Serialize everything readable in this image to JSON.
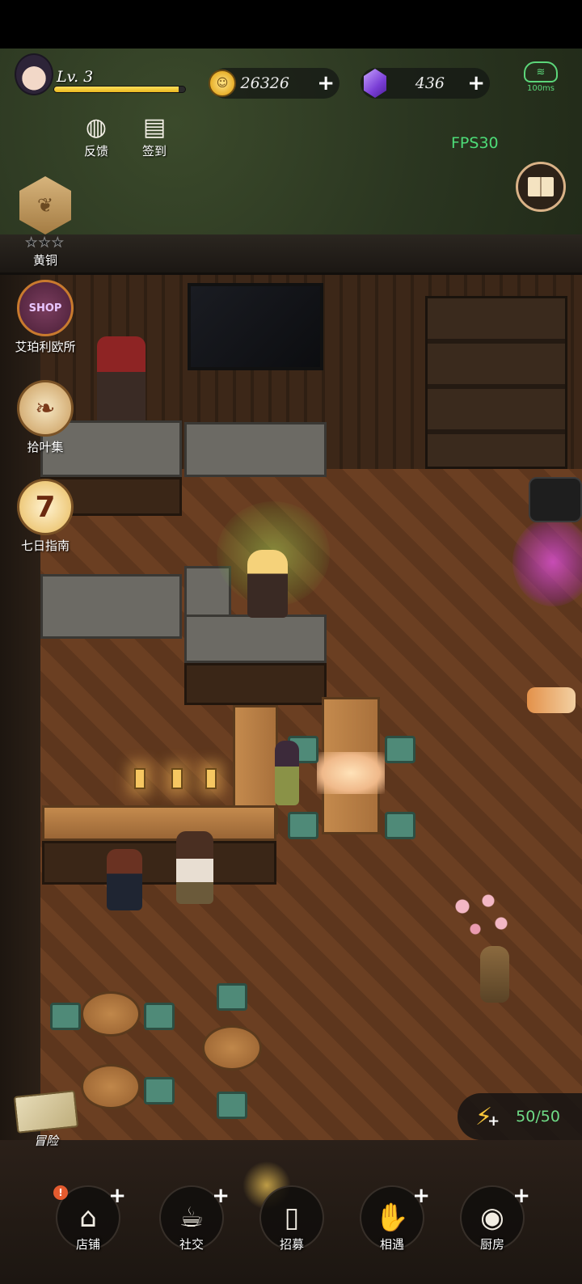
{
  "player": {
    "level_label": "Lv. 3",
    "xp_fraction": 0.95
  },
  "currency": {
    "coins": "26326",
    "gems": "436",
    "add_symbol": "+"
  },
  "network": {
    "latency": "100ms"
  },
  "fps_label": "FPS30",
  "top_buttons": {
    "feedback": "反馈",
    "signin": "签到"
  },
  "side_menu": {
    "rank": "黄铜",
    "rank_stars": "★★★",
    "shop": "艾珀利欧所",
    "shop_badge": "SHOP",
    "leaf": "拾叶集",
    "guide": "七日指南",
    "guide_badge": "7"
  },
  "adventure": "冒险",
  "energy": {
    "value": "50/50"
  },
  "bottom_nav": {
    "store": "店铺",
    "social": "社交",
    "recruit": "招募",
    "meet": "相遇",
    "kitchen": "厨房",
    "alert": "!"
  },
  "icons": {
    "coin": "coin-icon",
    "gem": "gem-icon",
    "network": "cloud-wifi-icon",
    "book": "book-icon",
    "energy": "lightning-icon"
  },
  "colors": {
    "fps": "#4ddc78",
    "energy_value": "#6fdc87",
    "xp_bar": "#ffe05a"
  }
}
